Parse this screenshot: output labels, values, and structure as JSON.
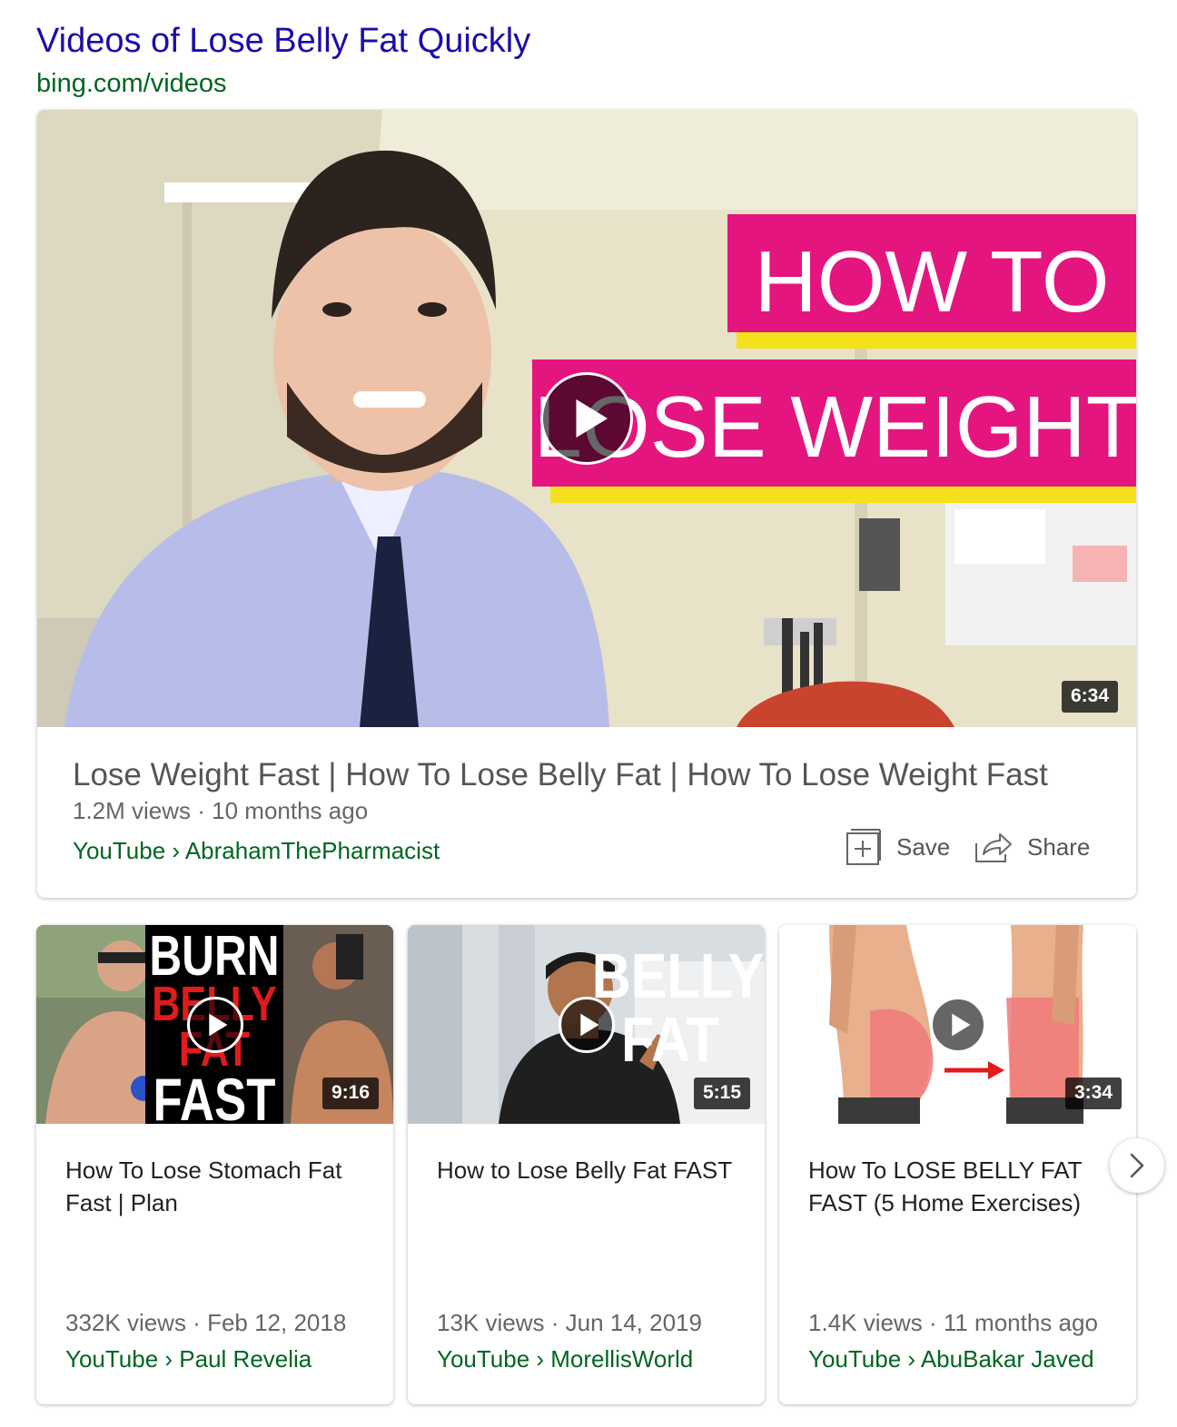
{
  "header": {
    "title": "Videos of Lose Belly Fat Quickly",
    "url": "bing.com/videos"
  },
  "main_video": {
    "thumbnail_text": [
      "HOW TO",
      "LOSE WEIGHT"
    ],
    "duration": "6:34",
    "title": "Lose Weight Fast | How To Lose Belly Fat | How To Lose Weight Fast",
    "meta": "1.2M views · 10 months ago",
    "source": "YouTube › AbrahamThePharmacist",
    "save_label": "Save",
    "share_label": "Share"
  },
  "videos": [
    {
      "thumbnail_text": [
        "BURN",
        "BELLY",
        "FAT",
        "FAST"
      ],
      "duration": "9:16",
      "title": "How To Lose Stomach Fat Fast | Plan",
      "meta": "332K views · Feb 12, 2018",
      "source": "YouTube › Paul Revelia"
    },
    {
      "thumbnail_text": [
        "BELLY",
        "FAT"
      ],
      "duration": "5:15",
      "title": "How to Lose Belly Fat FAST",
      "meta": "13K views · Jun 14, 2019",
      "source": "YouTube › MorellisWorld"
    },
    {
      "duration": "3:34",
      "title": "How To LOSE BELLY FAT FAST (5 Home Exercises)",
      "meta": "1.4K views · 11 months ago",
      "source": "YouTube › AbuBakar Javed"
    }
  ],
  "icons": {
    "play": "play-icon",
    "save": "add-to-collection-icon",
    "share": "share-icon",
    "next": "chevron-right-icon"
  },
  "colors": {
    "title_link": "#1a0dab",
    "url_green": "#006621",
    "thumbnail_pink": "#e5157f",
    "thumbnail_yellow": "#f4e11c"
  }
}
